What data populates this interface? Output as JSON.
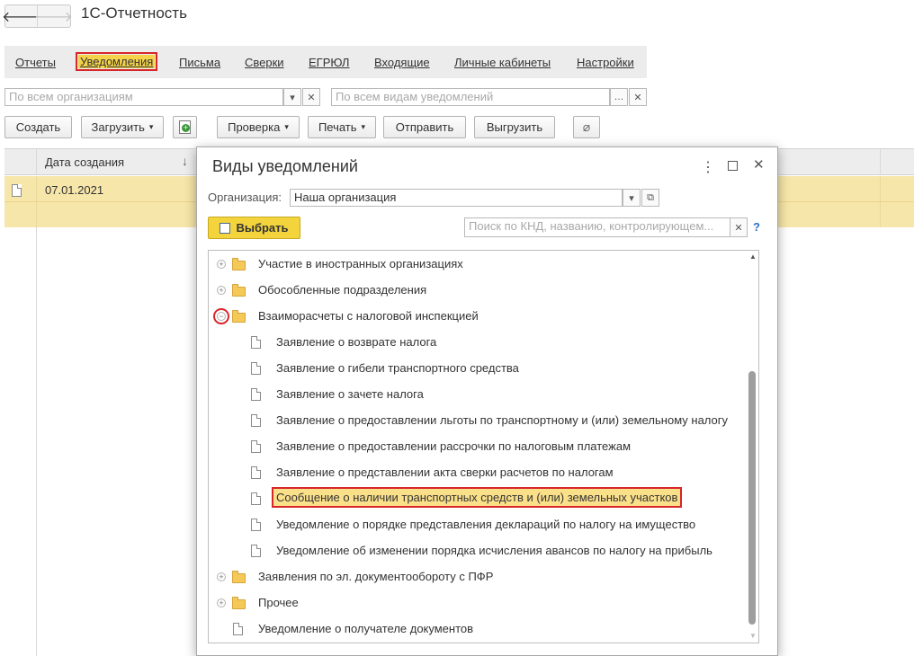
{
  "app": {
    "title": "1С-Отчетность",
    "back_icon": "arrow-left-icon",
    "forward_icon": "arrow-right-icon"
  },
  "tabs": [
    {
      "label": "Отчеты",
      "active": false
    },
    {
      "label": "Уведомления",
      "active": true
    },
    {
      "label": "Письма",
      "active": false
    },
    {
      "label": "Сверки",
      "active": false
    },
    {
      "label": "ЕГРЮЛ",
      "active": false
    },
    {
      "label": "Входящие",
      "active": false
    },
    {
      "label": "Личные кабинеты",
      "active": false
    },
    {
      "label": "Настройки",
      "active": false
    }
  ],
  "filters": {
    "organization_placeholder": "По всем организациям",
    "kind_placeholder": "По всем видам уведомлений"
  },
  "toolbar": {
    "create": "Создать",
    "load": "Загрузить",
    "check": "Проверка",
    "print": "Печать",
    "send": "Отправить",
    "export": "Выгрузить"
  },
  "table": {
    "columns": [
      "Дата создания"
    ],
    "rows": [
      {
        "date": "07.01.2021"
      }
    ]
  },
  "dialog": {
    "title": "Виды уведомлений",
    "org_label": "Организация:",
    "org_value": "Наша организация",
    "choose_label": "Выбрать",
    "search_placeholder": "Поиск по КНД, названию, контролирующем...",
    "help": "?",
    "tree": [
      {
        "label": "Участие в иностранных организациях",
        "type": "folder",
        "expanded": false,
        "level": 0
      },
      {
        "label": "Обособленные подразделения",
        "type": "folder",
        "expanded": false,
        "level": 0
      },
      {
        "label": "Взаиморасчеты с налоговой инспекцией",
        "type": "folder",
        "expanded": true,
        "level": 0
      },
      {
        "label": "Заявление о возврате налога",
        "type": "doc",
        "level": 1
      },
      {
        "label": "Заявление о гибели транспортного средства",
        "type": "doc",
        "level": 1
      },
      {
        "label": "Заявление о зачете налога",
        "type": "doc",
        "level": 1
      },
      {
        "label": "Заявление о предоставлении льготы по транспортному и (или) земельному налогу",
        "type": "doc",
        "level": 1
      },
      {
        "label": "Заявление о предоставлении рассрочки по налоговым платежам",
        "type": "doc",
        "level": 1
      },
      {
        "label": "Заявление о представлении акта сверки расчетов по налогам",
        "type": "doc",
        "level": 1
      },
      {
        "label": "Сообщение о наличии транспортных средств и (или) земельных участков",
        "type": "doc",
        "level": 1,
        "selected": true
      },
      {
        "label": "Уведомление о порядке представления деклараций по налогу на имущество",
        "type": "doc",
        "level": 1
      },
      {
        "label": "Уведомление об изменении порядка исчисления авансов по налогу на прибыль",
        "type": "doc",
        "level": 1
      },
      {
        "label": "Заявления по эл. документообороту с ПФР",
        "type": "folder",
        "expanded": false,
        "level": 0
      },
      {
        "label": "Прочее",
        "type": "folder",
        "expanded": false,
        "level": 0
      },
      {
        "label": "Уведомление о получателе документов",
        "type": "doc",
        "level": 0
      }
    ]
  },
  "colors": {
    "accent_yellow": "#f3d43c",
    "highlight_red": "#d7262a",
    "row_selected": "#f6e6a9"
  }
}
